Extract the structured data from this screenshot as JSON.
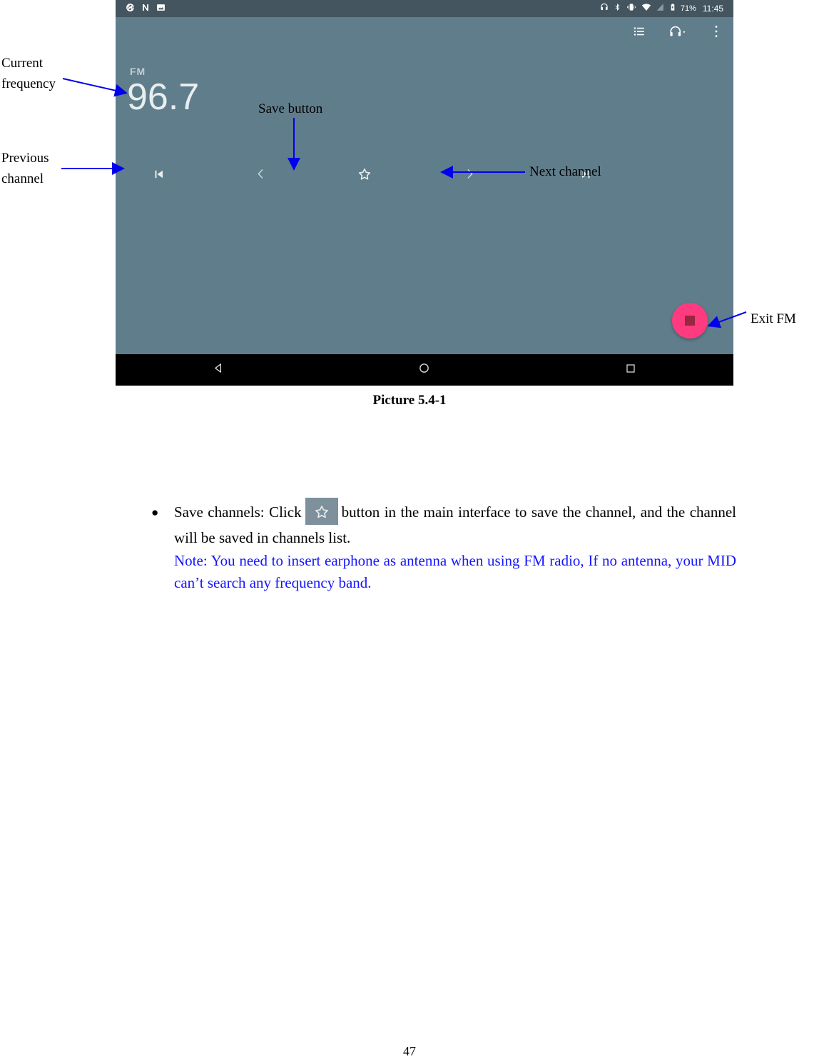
{
  "figure": {
    "caption": "Picture 5.4-1",
    "statusbar": {
      "left_icons": [
        "aperture-icon",
        "letter-n-icon",
        "image-icon"
      ],
      "right_icons": [
        "headphone-icon",
        "bluetooth-icon",
        "vibrate-icon",
        "wifi-icon",
        "signal-icon",
        "battery-charging-icon"
      ],
      "battery_percent": "71%",
      "time": "11:45"
    },
    "toolbar": {
      "list_label": "list-icon",
      "headphone_label": "headphone-dropdown-icon",
      "overflow_label": "overflow-menu-icon"
    },
    "radio": {
      "band_label": "FM",
      "frequency": "96.7"
    },
    "controls": [
      {
        "name": "previous-station",
        "icon": "skip-previous-icon"
      },
      {
        "name": "tune-down",
        "icon": "chevron-left-icon"
      },
      {
        "name": "save-channel",
        "icon": "star-outline-icon"
      },
      {
        "name": "tune-up",
        "icon": "chevron-right-icon"
      },
      {
        "name": "next-station",
        "icon": "skip-next-icon"
      }
    ],
    "fab": {
      "name": "exit-fm-button",
      "icon": "stop-square-icon"
    },
    "navbar": [
      {
        "name": "back-button",
        "icon": "triangle-back-icon"
      },
      {
        "name": "home-button",
        "icon": "circle-home-icon"
      },
      {
        "name": "recents-button",
        "icon": "square-recents-icon"
      }
    ],
    "colors": {
      "statusbar_bg": "#44555f",
      "app_bg": "#607d8b",
      "navbar_bg": "#000000",
      "fab_bg": "#ff3b7f",
      "fab_icon": "#96273f",
      "annotation_arrow": "#0000ee",
      "note_text": "#1414ff"
    }
  },
  "annotations": {
    "current_frequency": "Current\nfrequency",
    "current_frequency_line1": "Current",
    "current_frequency_line2": "frequency",
    "previous_channel_line1": "Previous",
    "previous_channel_line2": "channel",
    "save_button": "Save button",
    "next_channel": "Next channel",
    "exit_fm": "Exit FM"
  },
  "document": {
    "bullet_mark": "●",
    "bullet_text_before": "Save channels: Click",
    "bullet_text_after": "button in the main interface to save the channel, and the channel will be saved in channels list.",
    "note_text": "Note: You need to insert earphone as antenna when using FM radio, If no antenna, your MID can’t search any frequency band.",
    "page_number": "47"
  }
}
